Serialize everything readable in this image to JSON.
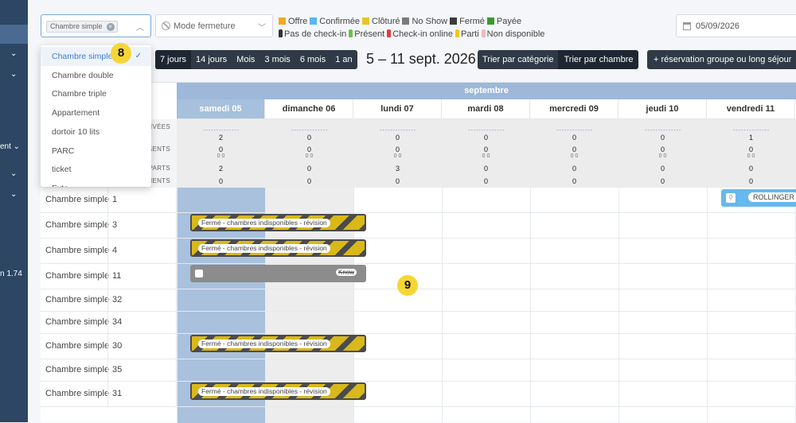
{
  "sidebar": {
    "partial_label": "ent",
    "version_label": "n 1.74"
  },
  "room_filter": {
    "chip": "Chambre simple"
  },
  "mode_select": {
    "placeholder": "Mode fermeture"
  },
  "legend": {
    "row1": [
      {
        "label": "Offre",
        "color": "#f5a623"
      },
      {
        "label": "Confirmée",
        "color": "#5bb5f0"
      },
      {
        "label": "Clôturé",
        "color": "#e8c42b"
      },
      {
        "label": "No Show",
        "color": "#7a7a7a"
      },
      {
        "label": "Fermé",
        "color": "#3b3b3b"
      },
      {
        "label": "Payée",
        "color": "#3a9a2c"
      }
    ],
    "row2": [
      {
        "label": "Pas de check-in",
        "color": "#333333"
      },
      {
        "label": "Présent",
        "color": "#6cc04a"
      },
      {
        "label": "Check-in online",
        "color": "#e03c3c"
      },
      {
        "label": "Parti",
        "color": "#f0c61e"
      },
      {
        "label": "Non disponible",
        "color": "#f2b8b8"
      }
    ]
  },
  "date_input": {
    "value": "05/09/2026"
  },
  "period": [
    "7 jours",
    "14 jours",
    "Mois",
    "3 mois",
    "6 mois",
    "1 an"
  ],
  "range_title": "5 – 11 sept. 2026",
  "sort": {
    "category": "Trier par catégorie",
    "room": "Trier par chambre"
  },
  "group_button": "+ réservation groupe ou long séjour",
  "calendar": {
    "month": "septembre",
    "days": [
      "samedi 05",
      "dimanche 06",
      "lundi 07",
      "mardi 08",
      "mercredi 09",
      "jeudi 10",
      "vendredi 11"
    ],
    "stat_labels": [
      "RIVÉES",
      "SENTS",
      "PARTS",
      "MENTS"
    ],
    "arrivals": [
      "2",
      "0",
      "0",
      "0",
      "0",
      "0",
      "1"
    ],
    "present": [
      "0",
      "0",
      "0",
      "0",
      "0",
      "0",
      "0"
    ],
    "departures": [
      "2",
      "0",
      "3",
      "0",
      "0",
      "0",
      "0"
    ],
    "occupancy": [
      "0",
      "0",
      "0",
      "0",
      "0",
      "0",
      "0"
    ],
    "icon_counts": "0   0",
    "rows": [
      {
        "type": "Chambre simple",
        "num": "1"
      },
      {
        "type": "Chambre simple",
        "num": "3"
      },
      {
        "type": "Chambre simple",
        "num": "4"
      },
      {
        "type": "Chambre simple",
        "num": "11"
      },
      {
        "type": "Chambre simple",
        "num": "32"
      },
      {
        "type": "Chambre simple",
        "num": "34"
      },
      {
        "type": "Chambre simple",
        "num": "30"
      },
      {
        "type": "Chambre simple",
        "num": "35"
      },
      {
        "type": "Chambre simple",
        "num": "31"
      }
    ],
    "closed_label": "Fermé - chambres indisponibles - révision",
    "grey_guest": "Know",
    "blue_guest": "ROLLINGER"
  },
  "dropdown": {
    "items": [
      "Chambre simple",
      "Chambre double",
      "Chambre triple",
      "Appartement",
      "dortoir 10 lits",
      "PARC",
      "ticket",
      "Exte"
    ]
  },
  "badges": {
    "b8": "8",
    "b9": "9"
  }
}
